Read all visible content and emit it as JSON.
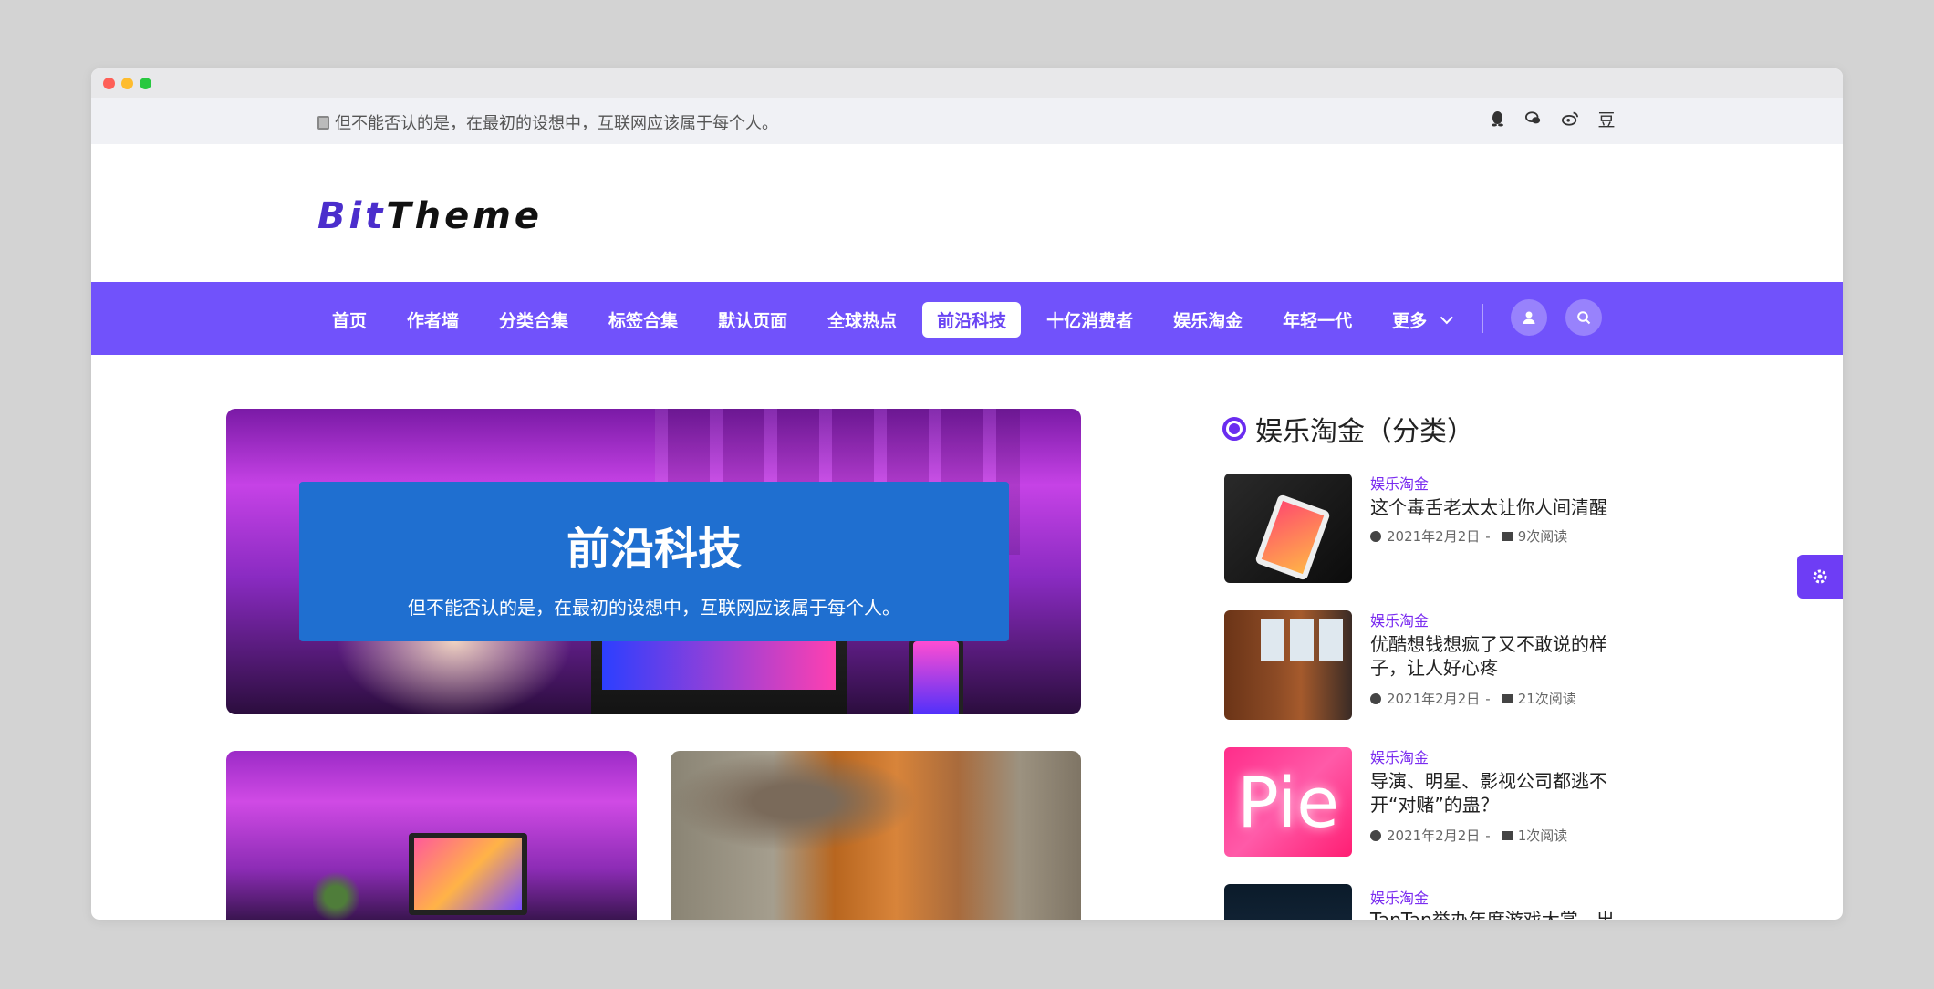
{
  "topbar": {
    "notice": "但不能否认的是，在最初的设想中，互联网应该属于每个人。",
    "social_icons": [
      "qq-icon",
      "wechat-icon",
      "weibo-icon",
      "douban-icon"
    ],
    "douban_label": "豆"
  },
  "logo": {
    "part1": "Bit",
    "part2": "Theme"
  },
  "nav": {
    "items": [
      {
        "label": "首页"
      },
      {
        "label": "作者墙"
      },
      {
        "label": "分类合集"
      },
      {
        "label": "标签合集"
      },
      {
        "label": "默认页面"
      },
      {
        "label": "全球热点"
      },
      {
        "label": "前沿科技",
        "active": true
      },
      {
        "label": "十亿消费者"
      },
      {
        "label": "娱乐淘金"
      },
      {
        "label": "年轻一代"
      },
      {
        "label": "更多"
      }
    ],
    "accent": "#7152fb"
  },
  "hero": {
    "title": "前沿科技",
    "subtitle": "但不能否认的是，在最初的设想中，互联网应该属于每个人。",
    "card_color": "#1f6fd0"
  },
  "sidebar": {
    "title": "娱乐淘金（分类）",
    "posts": [
      {
        "category": "娱乐淘金",
        "title": "这个毒舌老太太让你人间清醒",
        "date": "2021年2月2日",
        "reads": "9次阅读"
      },
      {
        "category": "娱乐淘金",
        "title": "优酷想钱想疯了又不敢说的样子，让人好心疼",
        "date": "2021年2月2日",
        "reads": "21次阅读"
      },
      {
        "category": "娱乐淘金",
        "title": "导演、明星、影视公司都逃不开“对赌”的蛊？",
        "date": "2021年2月2日",
        "reads": "1次阅读"
      },
      {
        "category": "娱乐淘金",
        "title": "TapTap举办年度游戏大赏，出"
      }
    ],
    "thumb3_text": "Pie"
  },
  "separator": "-"
}
